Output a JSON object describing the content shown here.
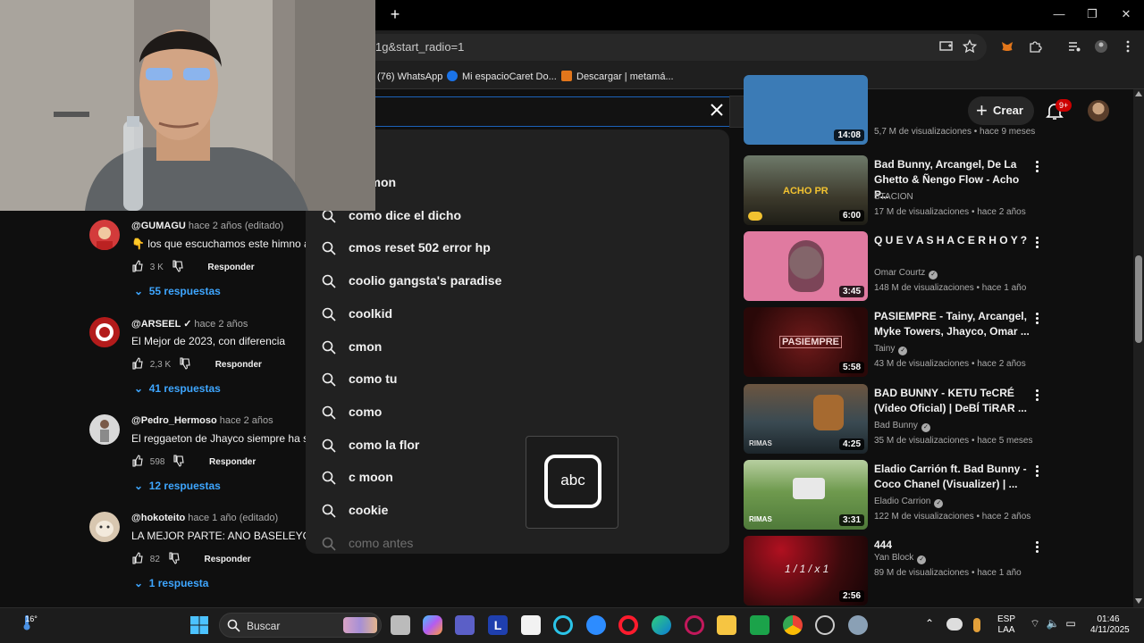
{
  "browser": {
    "url_fragment": "1g&start_radio=1",
    "new_tab_label": "+",
    "bookmarks": [
      {
        "label": "(76) WhatsApp",
        "color": "#25d366"
      },
      {
        "label": "Mi espacioCaret Do...",
        "color": "#1a73e8"
      },
      {
        "label": "Descargar | metamá...",
        "color": "#e2761b"
      }
    ],
    "window_controls": [
      "—",
      "❐",
      "✕"
    ]
  },
  "header": {
    "create_label": "Crear",
    "notifications_badge": "9+"
  },
  "search": {
    "suggestions": [
      "n c'mon",
      "como dice el dicho",
      "cmos reset 502 error hp",
      "coolio gangsta's paradise",
      "coolkid",
      "cmon",
      "como tu",
      "como",
      "como la flor",
      "c moon",
      "cookie",
      "como antes"
    ]
  },
  "ime": {
    "label": "abc"
  },
  "comments": [
    {
      "author": "@GUMAGU",
      "time": "hace 2 años (editado)",
      "text": "👇 los que escuchamos este himno a",
      "likes": "3 K",
      "reply": "Responder",
      "replies": "55 respuestas",
      "avatar_color": "#d33b3b"
    },
    {
      "author": "@ARSEEL ✓",
      "time": "hace 2 años",
      "text": "El Mejor de 2023, con diferencia",
      "likes": "2,3 K",
      "reply": "Responder",
      "replies": "41 respuestas",
      "avatar_color": "#b31b1b"
    },
    {
      "author": "@Pedro_Hermoso",
      "time": "hace 2 años",
      "text": "El reggaeton de Jhayco siempre ha si",
      "likes": "598",
      "reply": "Responder",
      "replies": "12 respuestas",
      "avatar_color": "#d9d9d9"
    },
    {
      "author": "@hokoteito",
      "time": "hace 1 año (editado)",
      "text": "LA MEJOR PARTE: ANO BASELEYO 😊",
      "likes": "82",
      "reply": "Responder",
      "replies": "1 respuesta",
      "avatar_color": "#d8c7b0"
    }
  ],
  "videos": [
    {
      "title": "",
      "channel": "",
      "meta": "5,7 M de visualizaciones • hace 9 meses",
      "duration": "14:08",
      "thumb": "#3b7bb6",
      "verified": false
    },
    {
      "title": "Bad Bunny, Arcangel, De La Ghetto & Ñengo Flow - Acho P...",
      "channel": "STACION",
      "meta": "17 M de visualizaciones • hace 2 años",
      "duration": "6:00",
      "thumb": "#3d3a2c",
      "thumb_text": "ACHO PR",
      "verified": false
    },
    {
      "title": "Q U E V A S H A C E R H O Y ?",
      "channel": "Omar Courtz",
      "meta": "148 M de visualizaciones • hace 1 año",
      "duration": "3:45",
      "thumb": "#e07aa0",
      "verified": true
    },
    {
      "title": "PASIEMPRE - Tainy, Arcangel, Myke Towers, Jhayco, Omar ...",
      "channel": "Tainy",
      "meta": "43 M de visualizaciones • hace 2 años",
      "duration": "5:58",
      "thumb": "#4a1414",
      "thumb_text": "PASIEMPRE",
      "verified": true
    },
    {
      "title": "BAD BUNNY - KETU TeCRÉ (Video Oficial) | DeBÍ TiRAR ...",
      "channel": "Bad Bunny",
      "meta": "35 M de visualizaciones • hace 5 meses",
      "duration": "4:25",
      "thumb": "#3a4a52",
      "thumb_text": "RIMAS",
      "verified": true
    },
    {
      "title": "Eladio Carrión ft. Bad Bunny - Coco Chanel (Visualizer) | ...",
      "channel": "Eladio Carrion",
      "meta": "122 M de visualizaciones • hace 2 años",
      "duration": "3:31",
      "thumb": "#4f7a3a",
      "thumb_text": "RIMAS",
      "verified": true
    },
    {
      "title": "444",
      "channel": "Yan Block",
      "meta": "89 M de visualizaciones • hace 1 año",
      "duration": "2:56",
      "thumb": "#3a0a0c",
      "thumb_text": "1 / 1 / x 1",
      "verified": true
    }
  ],
  "taskbar": {
    "weather": "16°",
    "search_label": "Buscar",
    "language": "ESP",
    "layout": "LAA",
    "time": "01:46",
    "date": "4/11/2025"
  }
}
